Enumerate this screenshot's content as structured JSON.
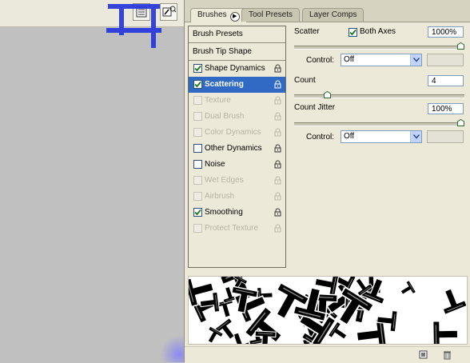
{
  "tabs": [
    {
      "label": "Brushes",
      "active": true
    },
    {
      "label": "Tool Presets",
      "active": false
    },
    {
      "label": "Layer Comps",
      "active": false
    }
  ],
  "brush_presets_label": "Brush Presets",
  "brush_tip_shape_label": "Brush Tip Shape",
  "options": [
    {
      "label": "Shape Dynamics",
      "checked": true,
      "enabled": true,
      "selected": false
    },
    {
      "label": "Scattering",
      "checked": true,
      "enabled": true,
      "selected": true
    },
    {
      "label": "Texture",
      "checked": false,
      "enabled": false,
      "selected": false
    },
    {
      "label": "Dual Brush",
      "checked": false,
      "enabled": false,
      "selected": false
    },
    {
      "label": "Color Dynamics",
      "checked": false,
      "enabled": false,
      "selected": false
    },
    {
      "label": "Other Dynamics",
      "checked": false,
      "enabled": true,
      "selected": false
    },
    {
      "label": "Noise",
      "checked": false,
      "enabled": true,
      "selected": false
    },
    {
      "label": "Wet Edges",
      "checked": false,
      "enabled": false,
      "selected": false
    },
    {
      "label": "Airbrush",
      "checked": false,
      "enabled": false,
      "selected": false
    },
    {
      "label": "Smoothing",
      "checked": true,
      "enabled": true,
      "selected": false
    },
    {
      "label": "Protect Texture",
      "checked": false,
      "enabled": false,
      "selected": false
    }
  ],
  "scatter": {
    "label": "Scatter",
    "both_axes_label": "Both Axes",
    "both_axes_checked": true,
    "value": "1000%",
    "slider_fraction": 1.0,
    "control_label": "Control:",
    "control_value": "Off"
  },
  "count": {
    "label": "Count",
    "value": "4",
    "slider_fraction": 0.18
  },
  "count_jitter": {
    "label": "Count Jitter",
    "value": "100%",
    "slider_fraction": 1.0,
    "control_label": "Control:",
    "control_value": "Off"
  },
  "colors": {
    "selected_row": "#316ac5",
    "accent_blue": "#2233dd"
  }
}
